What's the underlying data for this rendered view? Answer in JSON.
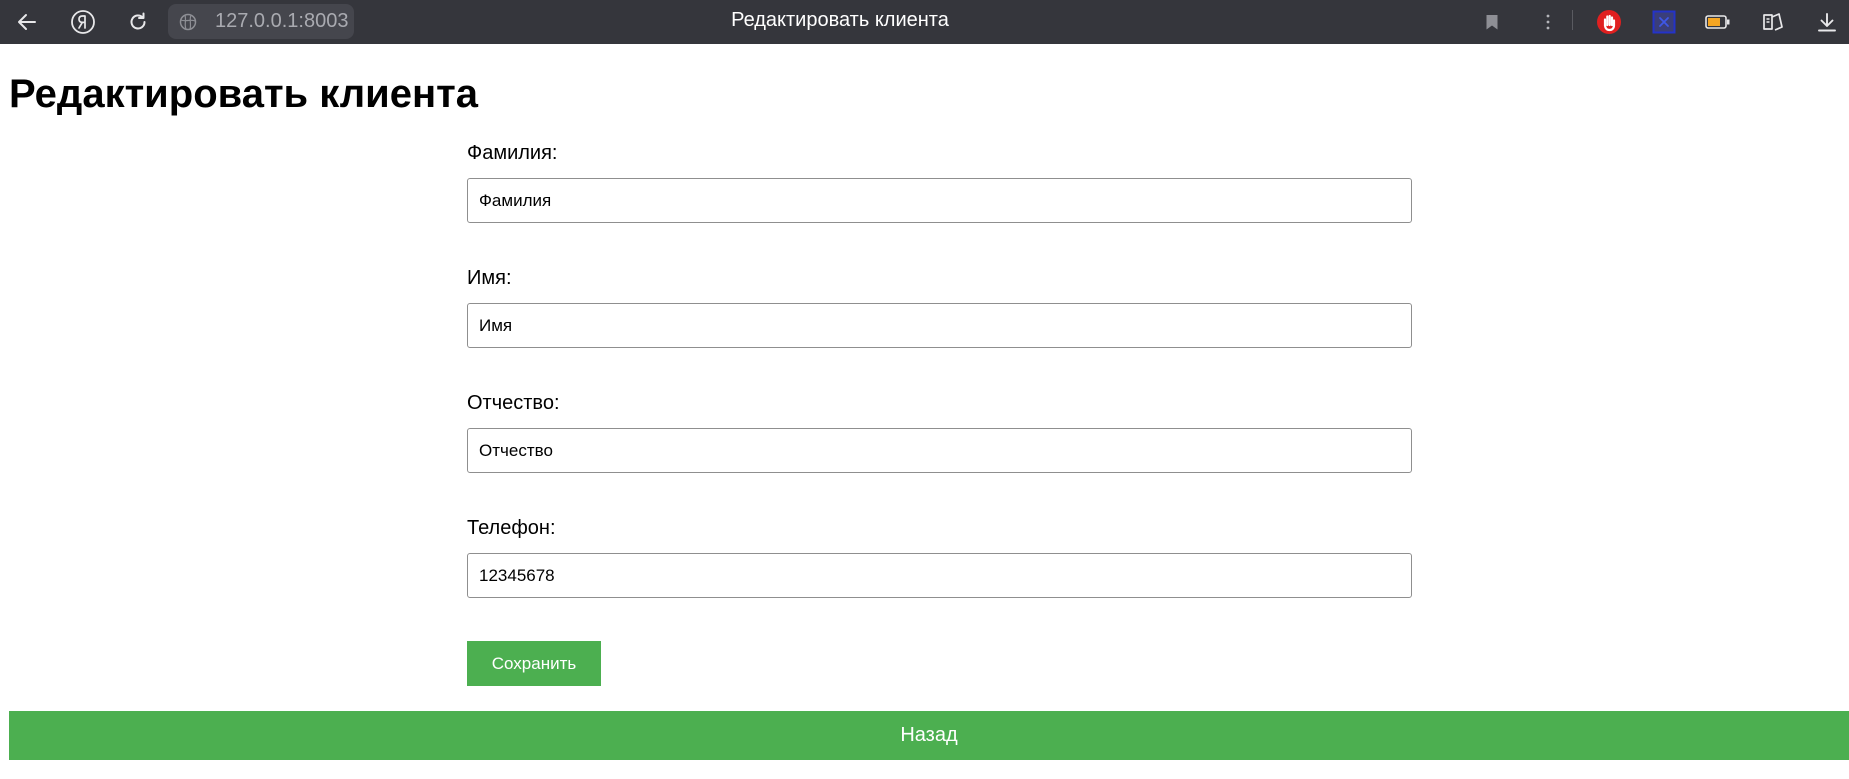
{
  "browser": {
    "address": "127.0.0.1:8003",
    "tab_title": "Редактировать клиента",
    "icons": {
      "back": "back-arrow-icon",
      "yandex": "yandex-logo-icon",
      "reload": "reload-icon",
      "site_info": "globe-icon",
      "bookmark": "bookmark-icon",
      "menu": "more-vertical-icon",
      "adblock": "stop-hand-icon",
      "extension": "extension-box-icon",
      "battery": "battery-icon",
      "collections": "collections-icon",
      "downloads": "download-icon"
    },
    "colors": {
      "bar": "#35363c",
      "address_pill": "#45464d",
      "adblock_red": "#e02020",
      "battery_fill": "#f5a623",
      "extension_blue": "#2433c8"
    }
  },
  "page": {
    "heading": "Редактировать клиента",
    "fields": [
      {
        "label": "Фамилия:",
        "value": "Фамилия"
      },
      {
        "label": "Имя:",
        "value": "Имя"
      },
      {
        "label": "Отчество:",
        "value": "Отчество"
      },
      {
        "label": "Телефон:",
        "value": "12345678"
      }
    ],
    "save_label": "Сохранить",
    "back_label": "Назад",
    "colors": {
      "accent_green": "#4caf50",
      "button_text": "#ffffff"
    }
  }
}
